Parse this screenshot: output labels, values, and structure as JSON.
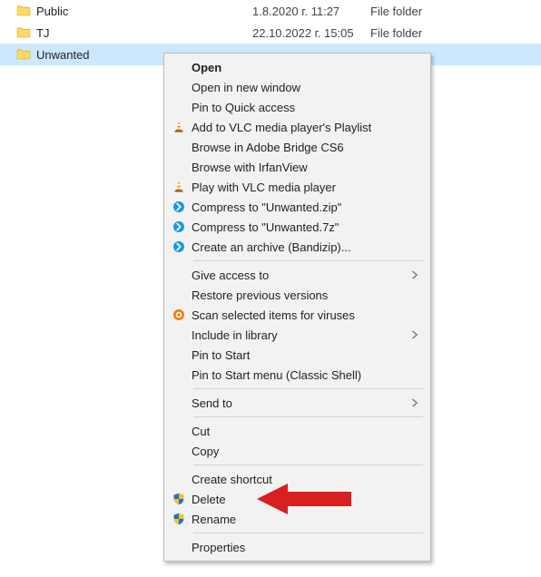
{
  "files": [
    {
      "name": "Public",
      "date": "1.8.2020 г. 11:27",
      "type": "File folder",
      "selected": false
    },
    {
      "name": "TJ",
      "date": "22.10.2022 г. 15:05",
      "type": "File folder",
      "selected": false
    },
    {
      "name": "Unwanted",
      "date": "",
      "type": "",
      "selected": true
    }
  ],
  "context_menu": [
    {
      "label": "Open",
      "icon": "",
      "bold": true
    },
    {
      "label": "Open in new window",
      "icon": ""
    },
    {
      "label": "Pin to Quick access",
      "icon": ""
    },
    {
      "label": "Add to VLC media player's Playlist",
      "icon": "vlc"
    },
    {
      "label": "Browse in Adobe Bridge CS6",
      "icon": ""
    },
    {
      "label": "Browse with IrfanView",
      "icon": ""
    },
    {
      "label": "Play with VLC media player",
      "icon": "vlc"
    },
    {
      "label": "Compress to \"Unwanted.zip\"",
      "icon": "bandizip"
    },
    {
      "label": "Compress to \"Unwanted.7z\"",
      "icon": "bandizip"
    },
    {
      "label": "Create an archive (Bandizip)...",
      "icon": "bandizip"
    },
    {
      "sep": true
    },
    {
      "label": "Give access to",
      "icon": "",
      "submenu": true
    },
    {
      "label": "Restore previous versions",
      "icon": ""
    },
    {
      "label": "Scan selected items for viruses",
      "icon": "avast"
    },
    {
      "label": "Include in library",
      "icon": "",
      "submenu": true
    },
    {
      "label": "Pin to Start",
      "icon": ""
    },
    {
      "label": "Pin to Start menu (Classic Shell)",
      "icon": ""
    },
    {
      "sep": true
    },
    {
      "label": "Send to",
      "icon": "",
      "submenu": true
    },
    {
      "sep": true
    },
    {
      "label": "Cut",
      "icon": ""
    },
    {
      "label": "Copy",
      "icon": ""
    },
    {
      "sep": true
    },
    {
      "label": "Create shortcut",
      "icon": ""
    },
    {
      "label": "Delete",
      "icon": "shield"
    },
    {
      "label": "Rename",
      "icon": "shield"
    },
    {
      "sep": true
    },
    {
      "label": "Properties",
      "icon": ""
    }
  ],
  "annotation": {
    "target": "Delete",
    "color": "#d8201f"
  }
}
